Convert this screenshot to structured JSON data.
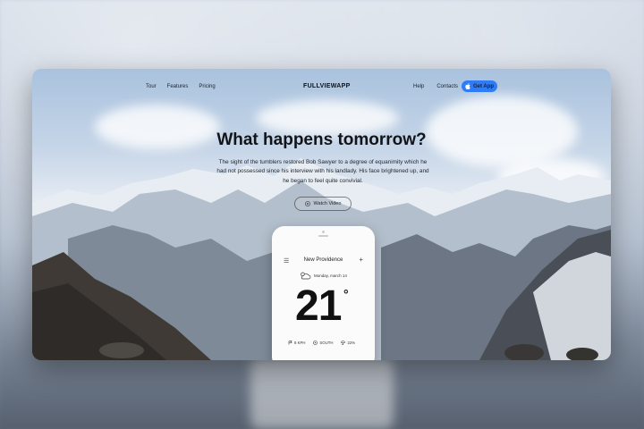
{
  "nav": {
    "left_links": [
      "Tour",
      "Features",
      "Pricing"
    ],
    "logo": "FULLVIEWAPP",
    "right_links": [
      "Help",
      "Contacts"
    ],
    "cta_label": "Get App",
    "cta_color": "#2f7cf6"
  },
  "hero": {
    "title": "What happens tomorrow?",
    "body": "The sight of the tumblers restored Bob Sawyer to a degree of equanimity which he had not possessed since his interview with his landlady. His face brightened up, and he began to feel quite convivial.",
    "watch_label": "Watch Video"
  },
  "phone": {
    "city": "New Providence",
    "date": "Monday, march 14",
    "temperature": "21",
    "degree_symbol": "°",
    "wind": "8 KPH",
    "direction": "SOUTH",
    "humidity": "22%",
    "weather_icon": "cloud-sun-icon"
  }
}
